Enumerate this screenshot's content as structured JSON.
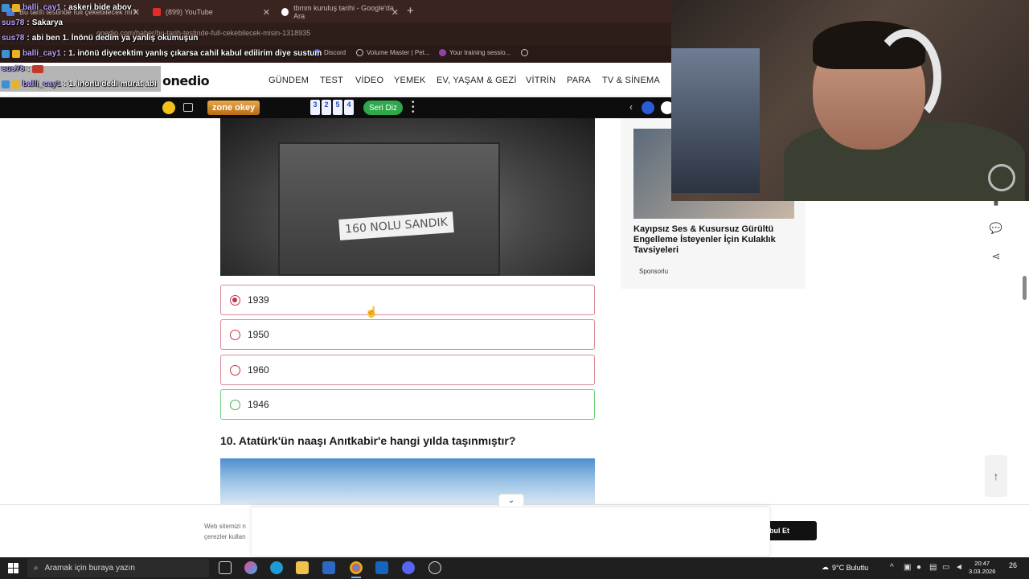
{
  "browser": {
    "tabs": [
      {
        "label": "Bu tarih testinde full çekebilecek mi?"
      },
      {
        "label": "(899) YouTube"
      },
      {
        "label": "tbmm kuruluş tarihi - Google'da Ara"
      }
    ],
    "new_tab_symbol": "+",
    "url": "onedio.com/haber/bu-tarih-testinde-full-cekebilecek-misin-1318935",
    "bookmarks": [
      "Discord",
      "Volume Master | Pet...",
      "Your training sessio..."
    ]
  },
  "chat": [
    {
      "user": "balli_cay1",
      "message": "askeri bide abov"
    },
    {
      "user": "sus78",
      "message": "Sakarya"
    },
    {
      "user": "sus78",
      "message": "abi ben 1. İnönü dedim ya yanlış okumuşun"
    },
    {
      "user": "balli_cay1",
      "message": "1. inönü diyecektim yanlış çıkarsa cahil kabul edilirim diye sustum"
    },
    {
      "user": "sus78",
      "message": ""
    },
    {
      "user": "balli_cay1",
      "message": "1. inönü dedi murat abi"
    }
  ],
  "site": {
    "logo": "onedio",
    "nav": [
      "GÜNDEM",
      "TEST",
      "VİDEO",
      "YEMEK",
      "EV, YAŞAM & GEZİ",
      "VİTRİN",
      "PARA",
      "TV & SİNEMA"
    ]
  },
  "zonebar": {
    "logo": "zone okey",
    "tiles": [
      "3",
      "2",
      "5",
      "4"
    ],
    "button": "Seri Diz"
  },
  "quiz": {
    "photo_label": "160 NOLU SANDIK",
    "options": [
      {
        "label": "1939",
        "state": "selected-wrong"
      },
      {
        "label": "1950",
        "state": "wrong"
      },
      {
        "label": "1960",
        "state": "wrong"
      },
      {
        "label": "1946",
        "state": "correct"
      }
    ],
    "next_question": "10. Atatürk'ün naaşı Anıtkabir'e hangi yılda taşınmıştır?"
  },
  "sidebar_ad": {
    "title": "Kayıpsız Ses & Kusursuz Gürültü Engelleme İsteyenler İçin Kulaklık Tavsiyeleri",
    "sponsor": "Sponsorlu"
  },
  "cookie": {
    "text_line1": "Web sitemizi n",
    "text_line2": "çerezler kullan",
    "accept": "bul Et"
  },
  "taskbar": {
    "search_placeholder": "Aramak için buraya yazın",
    "weather": "9°C Bulutlu",
    "time": "20:47",
    "date": "3.03.2026",
    "notifications": "26"
  },
  "colors": {
    "wrong_border": "#d98a96",
    "correct_border": "#6fcf7c",
    "accent_red": "#c53446",
    "accent_green": "#3fb24f"
  }
}
